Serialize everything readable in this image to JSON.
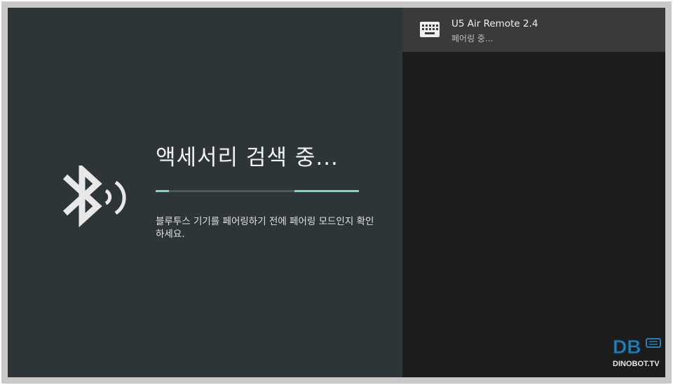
{
  "screen": {
    "title": "액세서리 검색 중...",
    "description": "블루투스 기기를 페어링하기 전에 페어링 모드인지 확인하세요.",
    "progress_fraction": 0.45,
    "icon": "bluetooth-searching-icon"
  },
  "device_list": {
    "items": [
      {
        "name": "U5 Air Remote 2.4",
        "status": "페어링 중...",
        "icon": "keyboard-icon"
      }
    ]
  },
  "watermark": {
    "logo_text": "DB",
    "site_text": "DINOBOT.TV"
  },
  "colors": {
    "left_background": "#2e3538",
    "right_background": "#1c1c1c",
    "accent": "#7fd6c4",
    "frame": "#c9c9c9"
  }
}
